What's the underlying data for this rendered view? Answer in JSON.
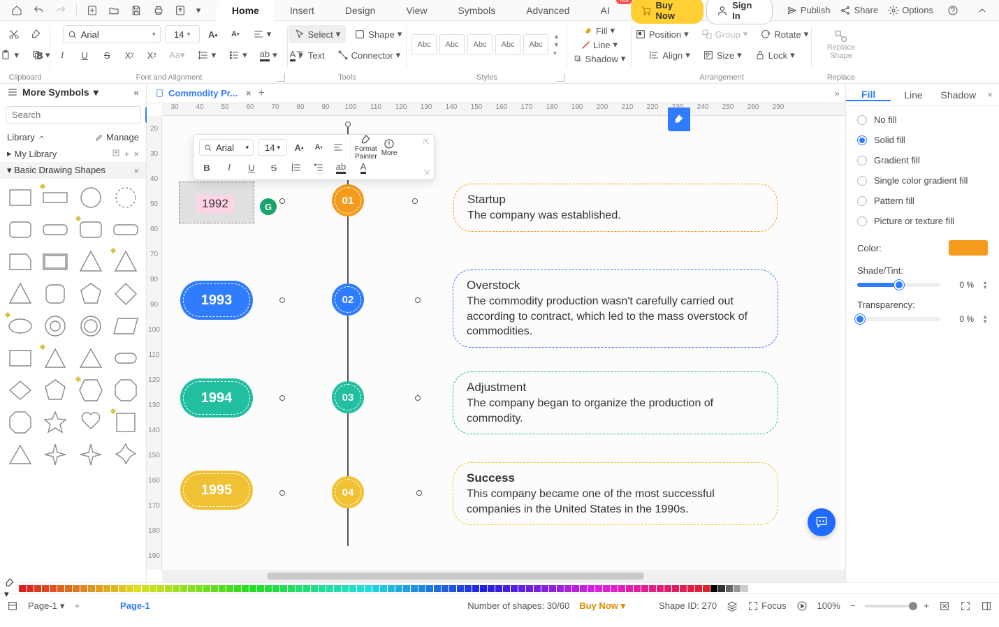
{
  "menubar": {
    "tabs": [
      "Home",
      "Insert",
      "Design",
      "View",
      "Symbols",
      "Advanced",
      "AI"
    ],
    "active": 0,
    "hotBadge": "hot",
    "buyNow": "Buy Now",
    "signIn": "Sign In",
    "right": [
      "Publish",
      "Share",
      "Options"
    ]
  },
  "ribbon": {
    "clipboard": {
      "label": "Clipboard"
    },
    "font": {
      "label": "Font and Alignment",
      "family": "Arial",
      "size": "14"
    },
    "tools": {
      "label": "Tools",
      "select": "Select",
      "shape": "Shape",
      "text": "Text",
      "connector": "Connector"
    },
    "styles": {
      "label": "Styles",
      "cards": [
        "Abc",
        "Abc",
        "Abc",
        "Abc",
        "Abc"
      ]
    },
    "shapeStyle": {
      "fill": "Fill",
      "line": "Line",
      "shadow": "Shadow"
    },
    "arrange": {
      "label": "Arrangement",
      "position": "Position",
      "group": "Group",
      "rotate": "Rotate",
      "align": "Align",
      "size": "Size",
      "lock": "Lock"
    },
    "replace": {
      "label": "Replace",
      "btn": "Replace\nShape"
    }
  },
  "left": {
    "title": "More Symbols",
    "searchPlaceholder": "Search",
    "searchBtn": "Search",
    "library": "Library",
    "manage": "Manage",
    "myLibrary": "My Library",
    "section": "Basic Drawing Shapes"
  },
  "doc": {
    "tabName": "Commodity Pr...",
    "hruler": [
      "30",
      "40",
      "50",
      "60",
      "70",
      "80",
      "90",
      "100",
      "110",
      "120",
      "130",
      "140",
      "150",
      "160",
      "170",
      "180",
      "190",
      "200",
      "210",
      "220",
      "230",
      "240",
      "250",
      "260",
      "290"
    ],
    "vruler": [
      "20",
      "30",
      "40",
      "50",
      "60",
      "70",
      "80",
      "90",
      "100",
      "110",
      "120",
      "130",
      "140",
      "150",
      "160",
      "170",
      "180",
      "190"
    ]
  },
  "mini": {
    "font": "Arial",
    "size": "14",
    "formatPainter": "Format\nPainter",
    "more": "More"
  },
  "timeline": {
    "years": [
      "1992",
      "1993",
      "1994",
      "1995"
    ],
    "nums": [
      "01",
      "02",
      "03",
      "04"
    ],
    "colors": [
      "#f39b1c",
      "#2f7cff",
      "#21bfa0",
      "#f0c233"
    ],
    "items": [
      {
        "title": "Startup",
        "body": "The company was established."
      },
      {
        "title": "Overstock",
        "body": "The commodity production wasn't carefully carried out according to contract, which led to the mass overstock of commodities."
      },
      {
        "title": "Adjustment",
        "body": "The company began to organize the production of commodity."
      },
      {
        "title": "Success",
        "body": "This company became one of the most successful companies in the United States in the 1990s."
      }
    ]
  },
  "rightPanel": {
    "tabs": [
      "Fill",
      "Line",
      "Shadow"
    ],
    "active": 0,
    "opts": [
      "No fill",
      "Solid fill",
      "Gradient fill",
      "Single color gradient fill",
      "Pattern fill",
      "Picture or texture fill"
    ],
    "selected": 1,
    "colorLabel": "Color:",
    "colorValue": "#f39b1c",
    "shadeLabel": "Shade/Tint:",
    "shadePct": "0 %",
    "transLabel": "Transparency:",
    "transPct": "0 %"
  },
  "status": {
    "pageSel": "Page-1",
    "pageTab": "Page-1",
    "numShapes": "Number of shapes: 30/60",
    "buyNow": "Buy Now",
    "shapeId": "Shape ID: 270",
    "focus": "Focus",
    "zoom": "100%"
  }
}
